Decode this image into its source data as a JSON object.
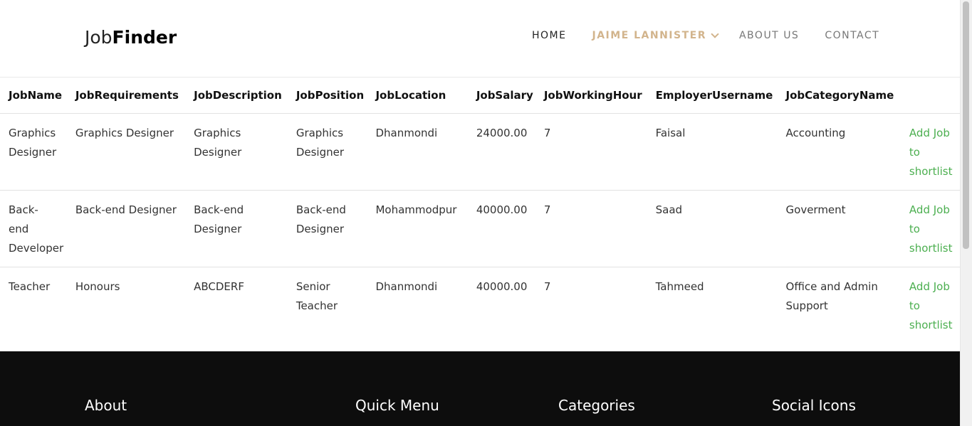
{
  "brand": {
    "light": "Job",
    "bold": "Finder"
  },
  "nav": {
    "home": "HOME",
    "user": "JAIME LANNISTER",
    "about": "ABOUT US",
    "contact": "CONTACT"
  },
  "table": {
    "headers": [
      "JobName",
      "JobRequirements",
      "JobDescription",
      "JobPosition",
      "JobLocation",
      "JobSalary",
      "JobWorkingHour",
      "EmployerUsername",
      "JobCategoryName"
    ],
    "rows": [
      [
        "Graphics Designer",
        "Graphics Designer",
        "Graphics Designer",
        "Graphics Designer",
        "Dhanmondi",
        "24000.00",
        "7",
        "Faisal",
        "Accounting",
        "Add Job to shortlist"
      ],
      [
        "Back-end Developer",
        "Back-end Designer",
        "Back-end Designer",
        "Back-end Designer",
        "Mohammodpur",
        "40000.00",
        "7",
        "Saad",
        "Goverment",
        "Add Job to shortlist"
      ],
      [
        "Teacher",
        "Honours",
        "ABCDERF",
        "Senior Teacher",
        "Dhanmondi",
        "40000.00",
        "7",
        "Tahmeed",
        "Office and Admin Support",
        "Add Job to shortlist"
      ]
    ]
  },
  "footer": {
    "about": "About",
    "quick_menu": "Quick Menu",
    "categories": "Categories",
    "social": "Social Icons"
  },
  "colors": {
    "accent_user": "#d2b48c",
    "link": "#4caf50",
    "footer_bg": "#0d0d0d"
  }
}
